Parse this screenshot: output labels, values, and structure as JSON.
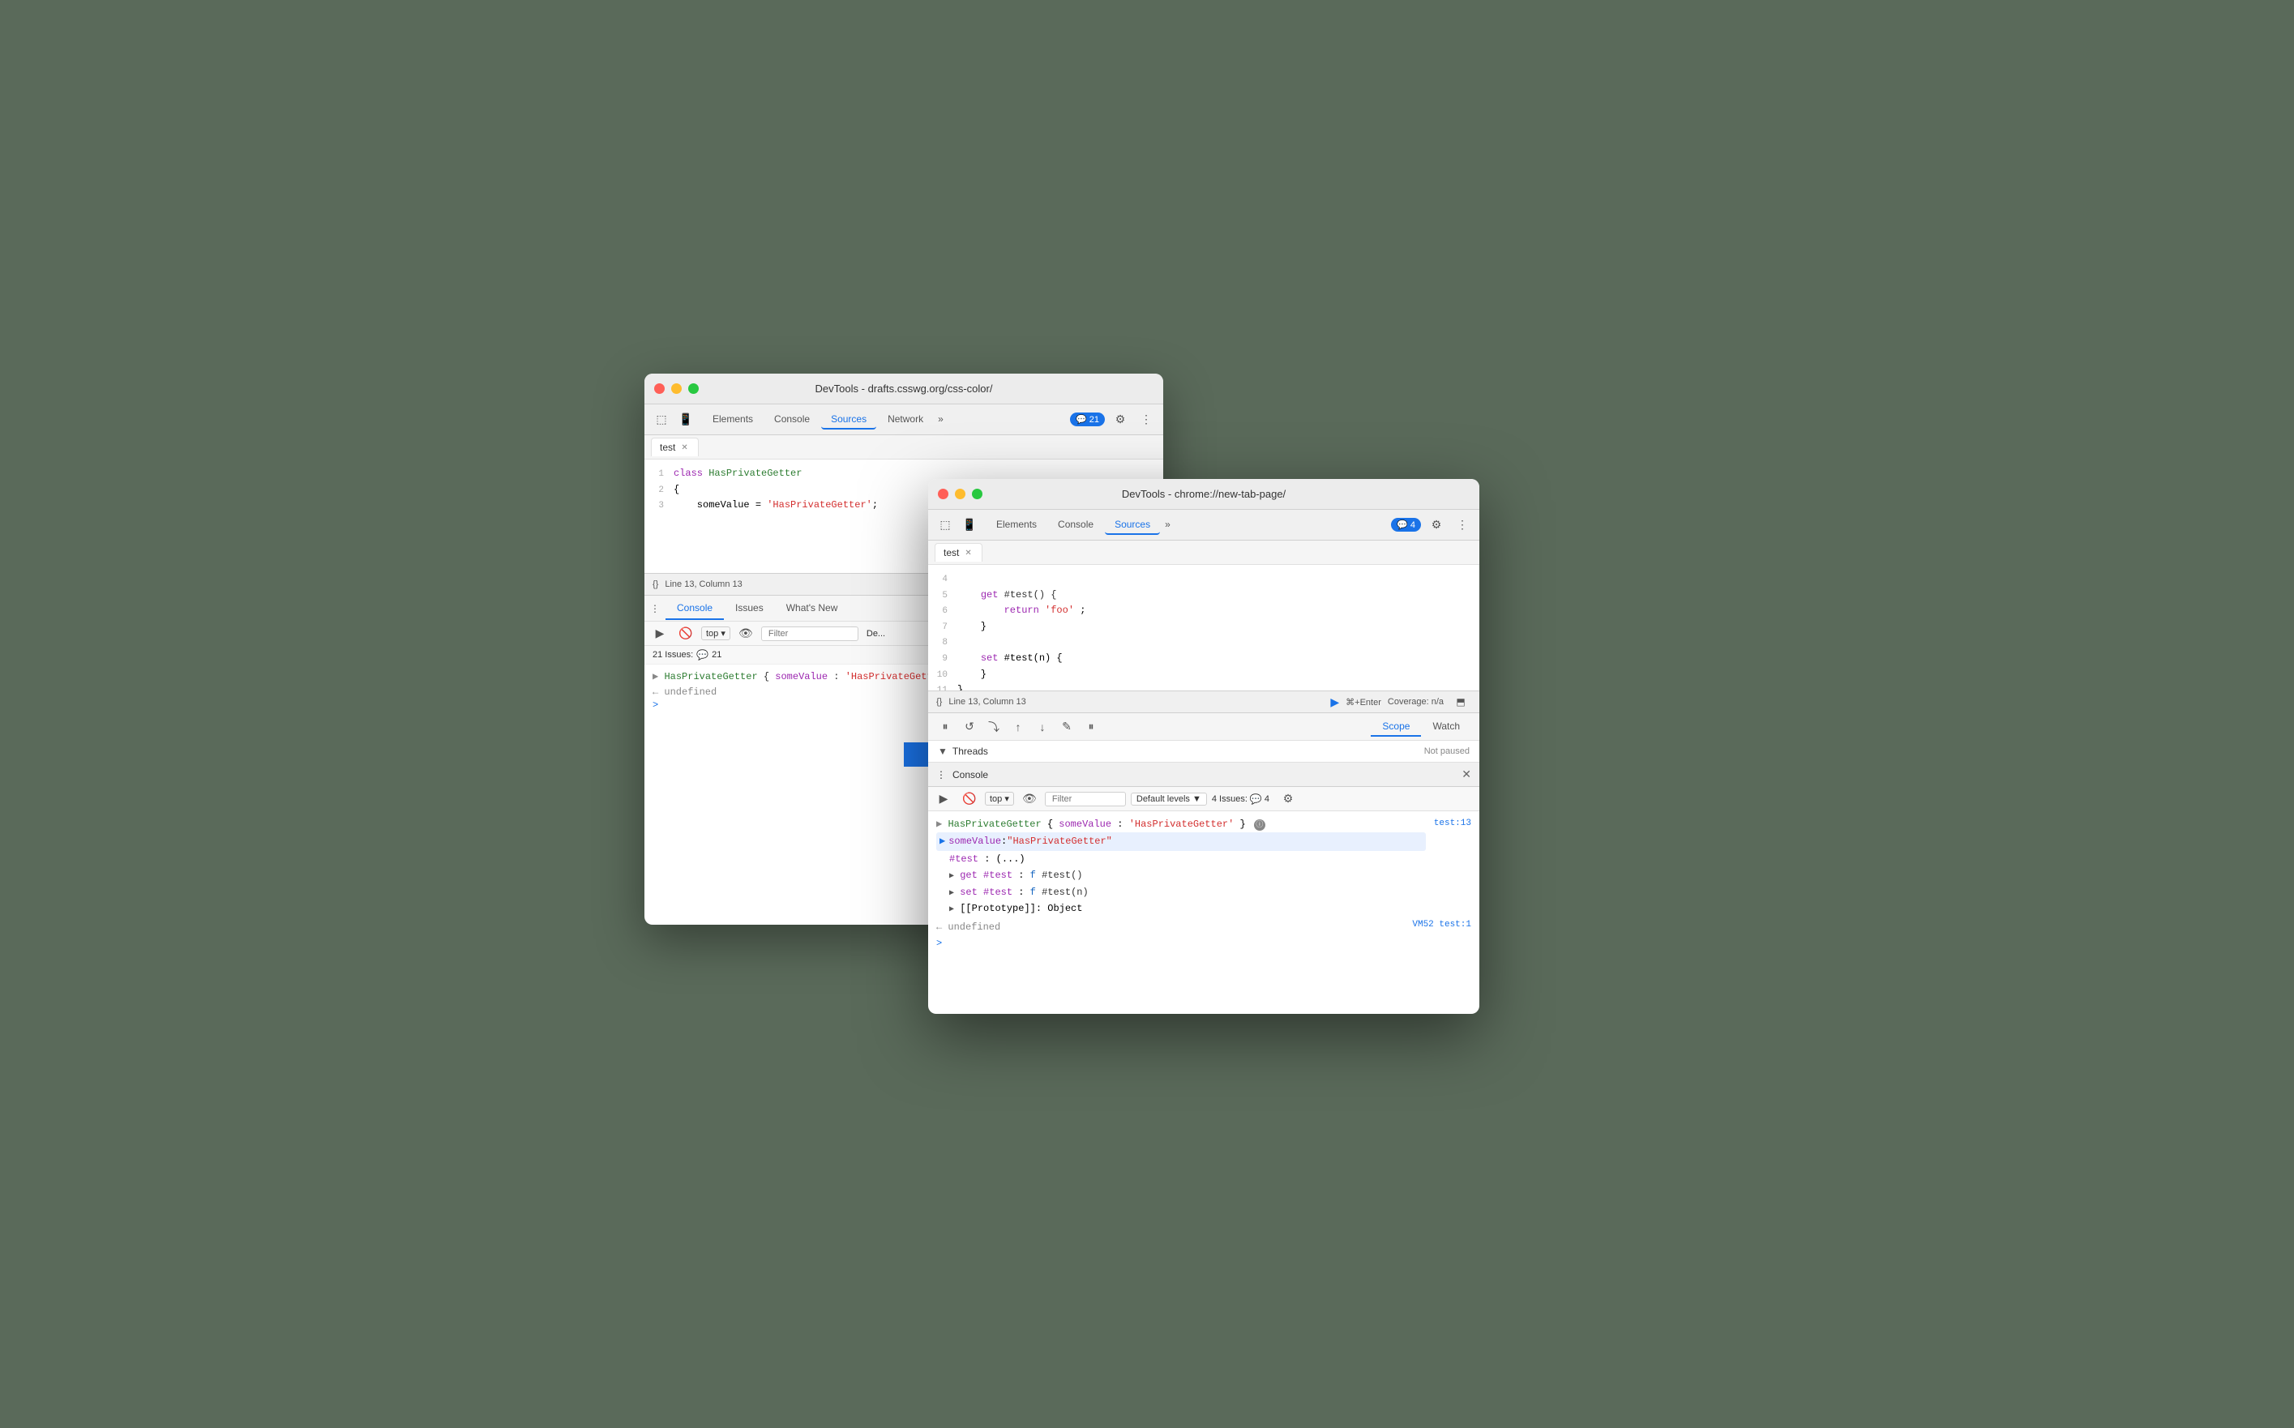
{
  "window_back": {
    "title": "DevTools - drafts.csswg.org/css-color/",
    "tabs": [
      "Elements",
      "Console",
      "Sources",
      "Network",
      "»"
    ],
    "active_tab": "Sources",
    "badge_count": "21",
    "file_tab": "test",
    "code_lines": [
      {
        "num": 1,
        "content": "class HasPrivateGetter",
        "tokens": [
          {
            "t": "keyword",
            "v": "class"
          },
          {
            "t": "space"
          },
          {
            "t": "classname",
            "v": "HasPrivateGetter"
          }
        ]
      },
      {
        "num": 2,
        "content": "{"
      },
      {
        "num": 3,
        "content": "    someValue = 'HasPrivateGetter';"
      }
    ],
    "status": "Line 13, Column 13",
    "console_tabs": [
      "Console",
      "Issues",
      "What's New"
    ],
    "active_console_tab": "Console",
    "filter_placeholder": "Filter",
    "top_label": "top",
    "issues_count": "21 Issues:",
    "issues_num": "21",
    "console_obj": "▶ HasPrivateGetter {someValue: 'HasPrivateGetter'}",
    "console_undefined": "← undefined",
    "console_prompt": ">"
  },
  "window_front": {
    "title": "DevTools - chrome://new-tab-page/",
    "tabs": [
      "Elements",
      "Console",
      "Sources",
      "»"
    ],
    "active_tab": "Sources",
    "badge_count": "4",
    "file_tab": "test",
    "code_lines": [
      {
        "num": 4,
        "content": ""
      },
      {
        "num": 5,
        "content": "    get #test() {"
      },
      {
        "num": 6,
        "content": "        return 'foo';"
      },
      {
        "num": 7,
        "content": "    }"
      },
      {
        "num": 8,
        "content": ""
      },
      {
        "num": 9,
        "content": "    set #test(n) {"
      },
      {
        "num": 10,
        "content": "    }"
      },
      {
        "num": 11,
        "content": "}"
      }
    ],
    "status": "Line 13, Column 13",
    "coverage": "Coverage: n/a",
    "debug_buttons": [
      "⏸",
      "↺",
      "⤵",
      "↑",
      "↓",
      "✎",
      "⏸"
    ],
    "scope_tabs": [
      "Scope",
      "Watch"
    ],
    "active_scope_tab": "Scope",
    "threads_label": "Threads",
    "not_paused": "Not paused",
    "console_panel": "Console",
    "filter_placeholder": "Filter",
    "top_label": "top",
    "default_levels": "Default levels ▼",
    "issues_count": "4 Issues:",
    "issues_num": "4",
    "console_obj_line": "▶ HasPrivateGetter {someValue: 'HasPrivateGetter'}",
    "obj_ref": "test:13",
    "expanded_props": [
      "someValue: \"HasPrivateGetter\"",
      "#test: (...)",
      "▶ get #test: f #test()",
      "▶ set #test: f #test(n)",
      "▶ [[Prototype]]: Object"
    ],
    "console_undefined": "← undefined",
    "vm_ref": "VM52 test:1",
    "console_prompt": ">"
  },
  "arrow": {
    "direction": "right",
    "color": "#1a73e8"
  }
}
